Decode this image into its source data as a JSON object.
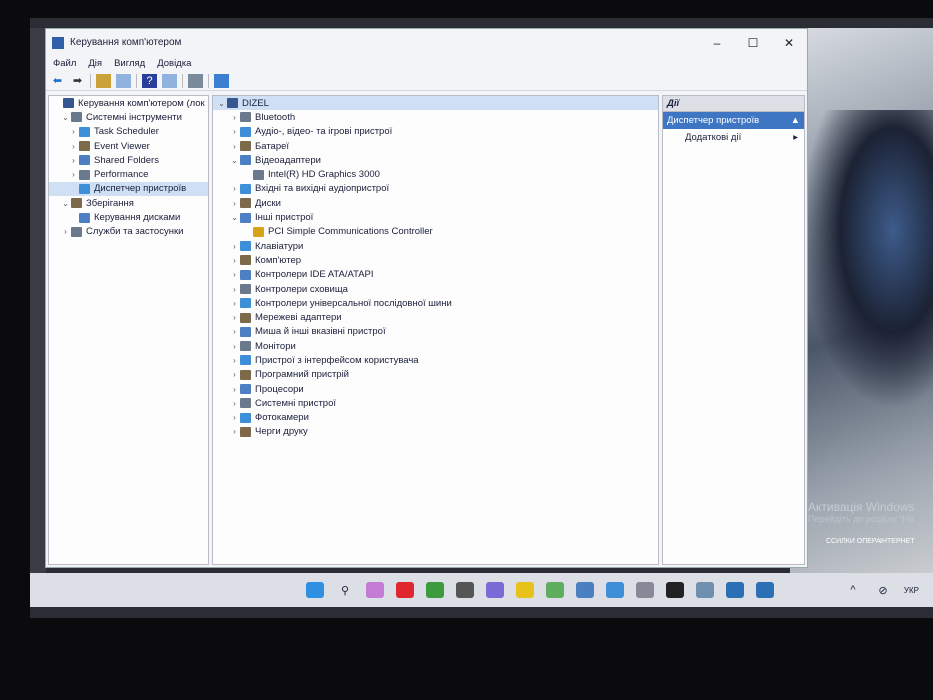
{
  "window": {
    "title": "Керування комп'ютером",
    "controls": [
      "–",
      "☐",
      "✕"
    ]
  },
  "menu": [
    "Файл",
    "Дія",
    "Вигляд",
    "Довідка"
  ],
  "left_tree": [
    {
      "label": "Керування комп'ютером (лок",
      "level": 0,
      "chev": ""
    },
    {
      "label": "Системні інструменти",
      "level": 1,
      "chev": "⌄"
    },
    {
      "label": "Task Scheduler",
      "level": 2,
      "chev": "›"
    },
    {
      "label": "Event Viewer",
      "level": 2,
      "chev": "›"
    },
    {
      "label": "Shared Folders",
      "level": 2,
      "chev": "›"
    },
    {
      "label": "Performance",
      "level": 2,
      "chev": "›"
    },
    {
      "label": "Диспетчер пристроїв",
      "level": 2,
      "chev": "",
      "selected": true
    },
    {
      "label": "Зберігання",
      "level": 1,
      "chev": "⌄"
    },
    {
      "label": "Керування дисками",
      "level": 2,
      "chev": ""
    },
    {
      "label": "Служби та застосунки",
      "level": 1,
      "chev": "›"
    }
  ],
  "device_tree": [
    {
      "label": "DIZEL",
      "level": 0,
      "chev": "⌄",
      "selected": true
    },
    {
      "label": "Bluetooth",
      "level": 1,
      "chev": "›"
    },
    {
      "label": "Аудіо-, відео- та ігрові пристрої",
      "level": 1,
      "chev": "›"
    },
    {
      "label": "Батареї",
      "level": 1,
      "chev": "›"
    },
    {
      "label": "Відеоадаптери",
      "level": 1,
      "chev": "⌄"
    },
    {
      "label": "Intel(R) HD Graphics 3000",
      "level": 2,
      "chev": ""
    },
    {
      "label": "Вхідні та вихідні аудіопристрої",
      "level": 1,
      "chev": "›"
    },
    {
      "label": "Диски",
      "level": 1,
      "chev": "›"
    },
    {
      "label": "Інші пристрої",
      "level": 1,
      "chev": "⌄"
    },
    {
      "label": "PCI Simple Communications Controller",
      "level": 2,
      "chev": "",
      "warning": true
    },
    {
      "label": "Клавіатури",
      "level": 1,
      "chev": "›"
    },
    {
      "label": "Комп'ютер",
      "level": 1,
      "chev": "›"
    },
    {
      "label": "Контролери IDE ATA/ATAPI",
      "level": 1,
      "chev": "›"
    },
    {
      "label": "Контролери сховища",
      "level": 1,
      "chev": "›"
    },
    {
      "label": "Контролери універсальної послідовної шини",
      "level": 1,
      "chev": "›"
    },
    {
      "label": "Мережеві адаптери",
      "level": 1,
      "chev": "›"
    },
    {
      "label": "Миша й інші вказівні пристрої",
      "level": 1,
      "chev": "›"
    },
    {
      "label": "Монітори",
      "level": 1,
      "chev": "›"
    },
    {
      "label": "Пристрої з інтерфейсом користувача",
      "level": 1,
      "chev": "›"
    },
    {
      "label": "Програмний пристрій",
      "level": 1,
      "chev": "›"
    },
    {
      "label": "Процесори",
      "level": 1,
      "chev": "›"
    },
    {
      "label": "Системні пристрої",
      "level": 1,
      "chev": "›"
    },
    {
      "label": "Фотокамери",
      "level": 1,
      "chev": "›"
    },
    {
      "label": "Черги друку",
      "level": 1,
      "chev": "›"
    }
  ],
  "actions": {
    "header": "Дії",
    "section": "Диспетчер пристроїв",
    "item": "Додаткові дії"
  },
  "desktop": {
    "activation_title": "Активація Windows",
    "activation_sub": "Перейдіть до розділу \"На",
    "icons": [
      "ССИЛКИ ОПЕРА",
      "ІНТЕРНЕТ"
    ]
  },
  "taskbar": {
    "language": "УКР",
    "apps": [
      "start",
      "search",
      "copilot",
      "opera",
      "chrome",
      "app",
      "media",
      "app2",
      "utorrent",
      "calculator",
      "notepad",
      "clock",
      "xbox",
      "camera",
      "app3",
      "device-manager"
    ]
  },
  "colors": {
    "accent": "#3f76c4",
    "selection": "#cfe0f5"
  }
}
